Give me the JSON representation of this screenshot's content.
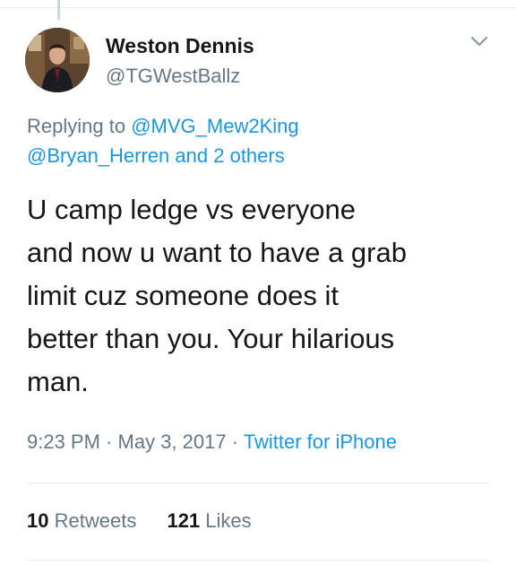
{
  "tweet": {
    "author_name": "Weston Dennis",
    "author_handle": "@TGWestBallz",
    "replying_prefix": "Replying to",
    "replying_to_first": "@MVG_Mew2King",
    "replying_to_second": "@Bryan_Herren",
    "replying_others": "and 2 others",
    "text_lines": [
      "U camp ledge vs everyone",
      "and now u want to have a grab",
      "limit cuz someone does it",
      "better than you. Your hilarious",
      "man."
    ],
    "time": "9:23 PM",
    "separator": "·",
    "date": "May 3, 2017",
    "source": "Twitter for iPhone"
  },
  "stats": {
    "retweets_count": "10",
    "retweets_label": "Retweets",
    "likes_count": "121",
    "likes_label": "Likes"
  },
  "icons": {
    "menu": "chevron-down-icon"
  },
  "colors": {
    "text": "#14171a",
    "secondary": "#657786",
    "link": "#1b95e0",
    "divider": "#e6ecf0"
  }
}
